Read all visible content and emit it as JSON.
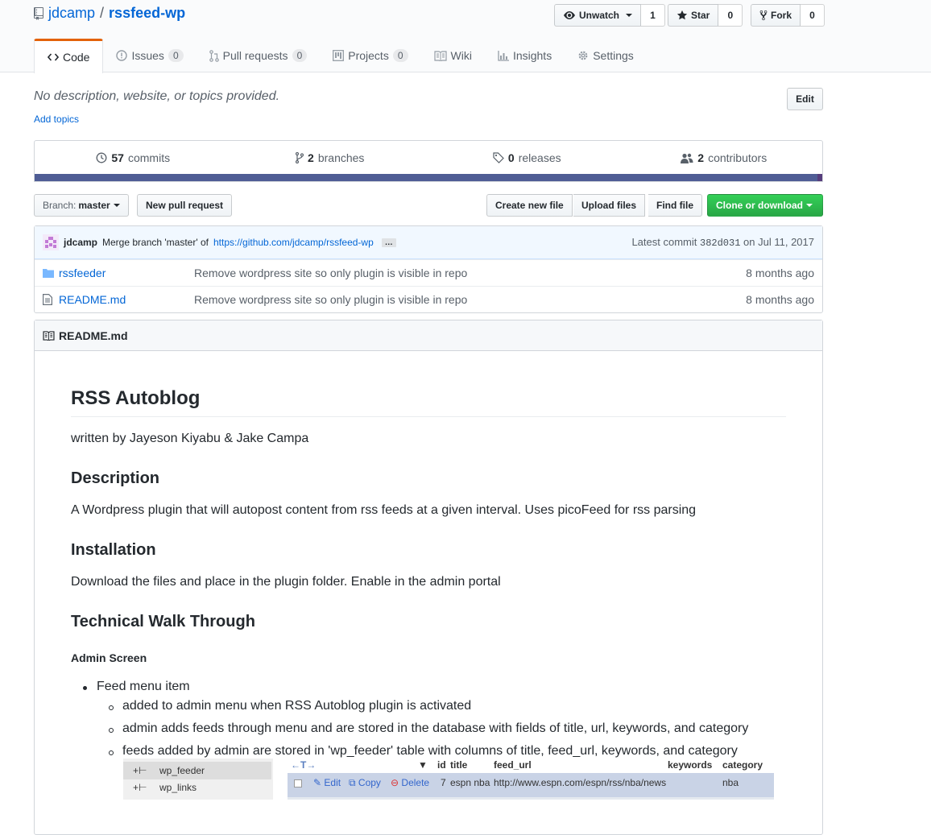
{
  "repo": {
    "owner": "jdcamp",
    "separator": "/",
    "name": "rssfeed-wp"
  },
  "actions": [
    {
      "label": "Unwatch",
      "count": "1",
      "icon": "eye-icon"
    },
    {
      "label": "Star",
      "count": "0",
      "icon": "star-icon"
    },
    {
      "label": "Fork",
      "count": "0",
      "icon": "fork-icon"
    }
  ],
  "tabs": {
    "code": "Code",
    "issues": "Issues",
    "issues_count": "0",
    "pulls": "Pull requests",
    "pulls_count": "0",
    "projects": "Projects",
    "projects_count": "0",
    "wiki": "Wiki",
    "insights": "Insights",
    "settings": "Settings"
  },
  "description": {
    "text": "No description, website, or topics provided.",
    "add_topics": "Add topics",
    "edit": "Edit"
  },
  "summary": {
    "commits_num": "57",
    "commits_label": "commits",
    "branches_num": "2",
    "branches_label": "branches",
    "releases_num": "0",
    "releases_label": "releases",
    "contributors_num": "2",
    "contributors_label": "contributors",
    "lang_colors": [
      "#4F5D95",
      "#563d7c"
    ]
  },
  "filenav": {
    "branch_prefix": "Branch:",
    "branch": "master",
    "new_pr": "New pull request",
    "create_file": "Create new file",
    "upload": "Upload files",
    "find": "Find file",
    "clone": "Clone or download"
  },
  "commit": {
    "author": "jdcamp",
    "message": "Merge branch 'master' of",
    "link": "https://github.com/jdcamp/rssfeed-wp",
    "ellipsis": "…",
    "latest_label": "Latest commit",
    "sha": "382d031",
    "date": "on Jul 11, 2017"
  },
  "files": [
    {
      "name": "rssfeeder",
      "type": "folder",
      "message": "Remove wordpress site so only plugin is visible in repo",
      "age": "8 months ago"
    },
    {
      "name": "README.md",
      "type": "file",
      "message": "Remove wordpress site so only plugin is visible in repo",
      "age": "8 months ago"
    }
  ],
  "readme": {
    "header": "README.md",
    "h1": "RSS Autoblog",
    "byline": "written by Jayeson Kiyabu & Jake Campa",
    "h_description": "Description",
    "description": "A Wordpress plugin that will autopost content from rss feeds at a given interval. Uses picoFeed for rss parsing",
    "h_installation": "Installation",
    "installation": "Download the files and place in the plugin folder. Enable in the admin portal",
    "h_walkthrough": "Technical Walk Through",
    "h_admin": "Admin Screen",
    "bullet1": "Feed menu item",
    "sub1": "added to admin menu when RSS Autoblog plugin is activated",
    "sub2": "admin adds feeds through menu and are stored in the database with fields of title, url, keywords, and category",
    "sub3": "feeds added by admin are stored in 'wp_feeder' table with columns of title, feed_url, keywords, and category"
  },
  "screenshot_image": {
    "tree": [
      "wp_feeder",
      "wp_links"
    ],
    "columns": [
      "id",
      "title",
      "feed_url",
      "keywords",
      "category"
    ],
    "row": {
      "edit": "Edit",
      "copy": "Copy",
      "delete": "Delete",
      "id": "7",
      "title": "espn nba",
      "feed_url": "http://www.espn.com/espn/rss/nba/news",
      "category": "nba"
    }
  }
}
